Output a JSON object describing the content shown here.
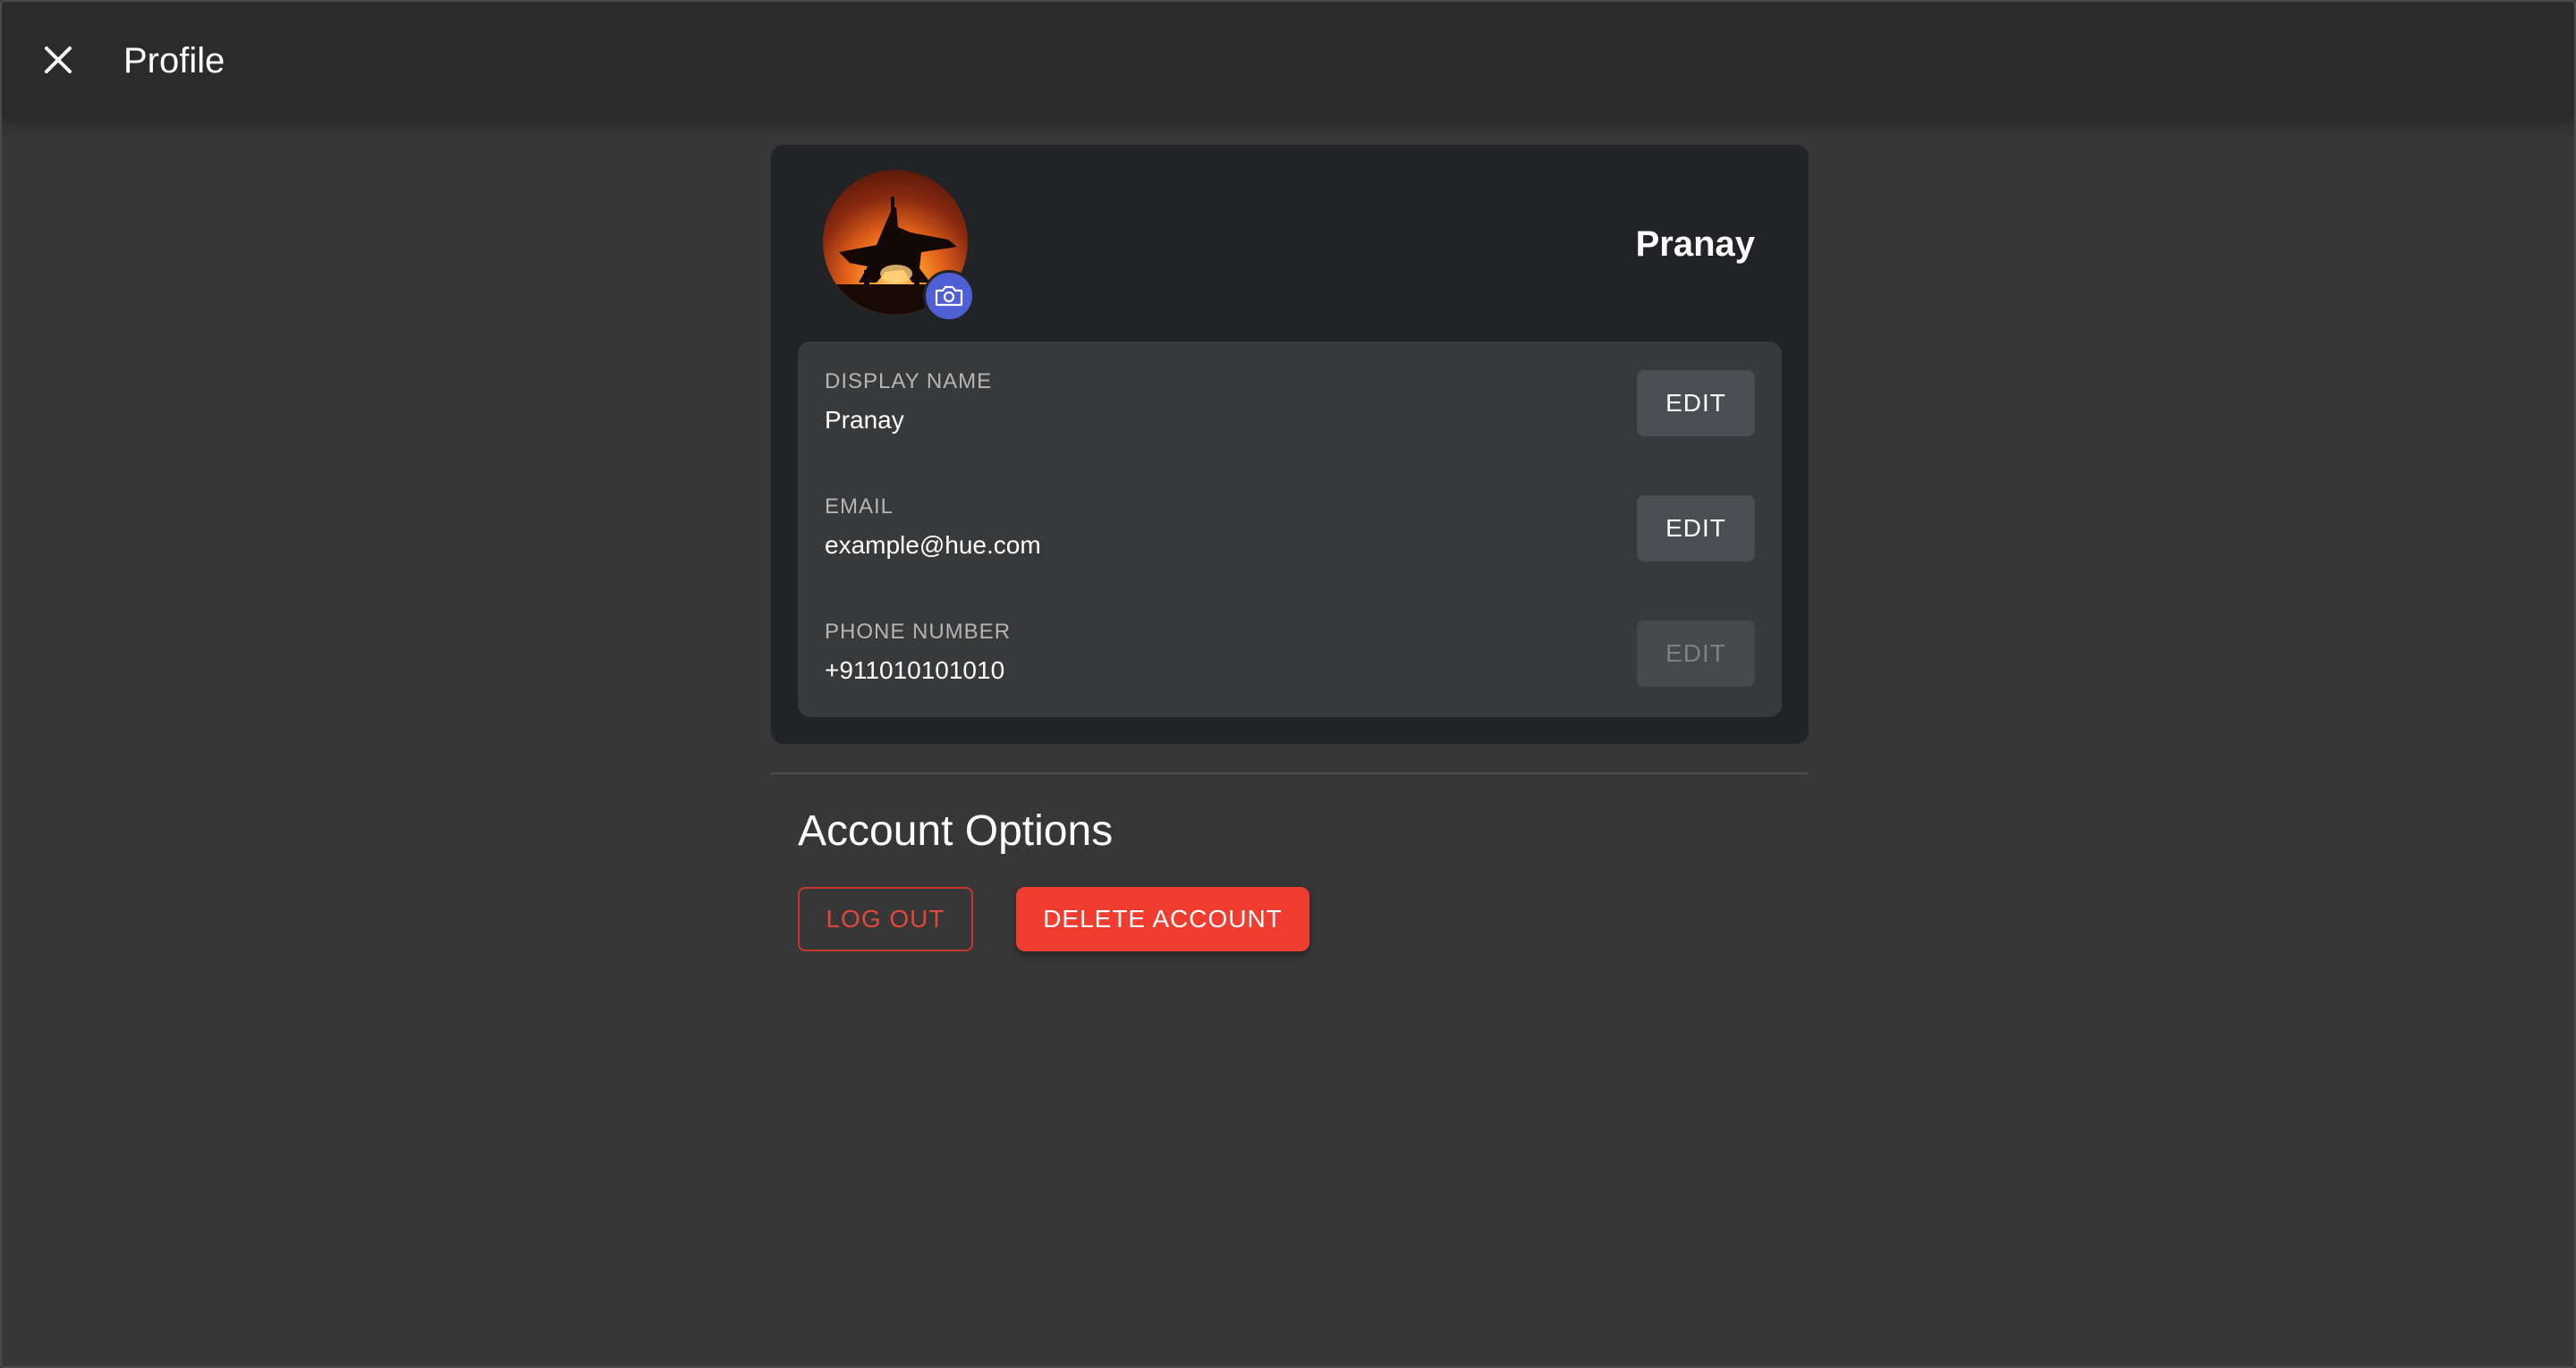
{
  "header": {
    "close_icon": "close-icon",
    "title": "Profile"
  },
  "profile": {
    "name": "Pranay",
    "avatar_icon": "avatar-photo",
    "camera_icon": "camera-icon",
    "camera_color": "#4f5fd6"
  },
  "fields": [
    {
      "label": "DISPLAY NAME",
      "value": "Pranay",
      "edit_label": "EDIT",
      "edit_enabled": true
    },
    {
      "label": "EMAIL",
      "value": "example@hue.com",
      "edit_label": "EDIT",
      "edit_enabled": true
    },
    {
      "label": "PHONE NUMBER",
      "value": "+911010101010",
      "edit_label": "EDIT",
      "edit_enabled": false
    }
  ],
  "account_options": {
    "title": "Account Options",
    "logout_label": "LOG OUT",
    "delete_label": "DELETE ACCOUNT",
    "danger_color": "#f03d30"
  }
}
